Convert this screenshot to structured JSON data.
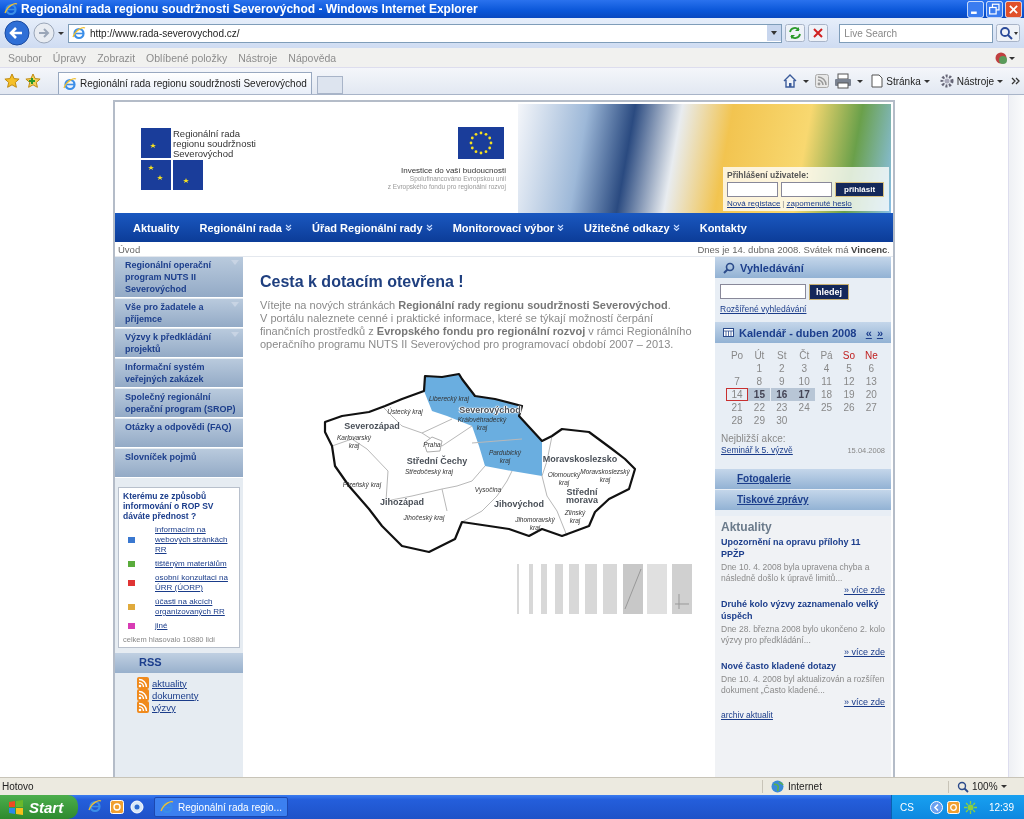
{
  "browser": {
    "title": "Regionální rada regionu soudržnosti Severovýchod - Windows Internet Explorer",
    "address": "http://www.rada-severovychod.cz/",
    "search_placeholder": "Live Search",
    "menu": [
      "Soubor",
      "Úpravy",
      "Zobrazit",
      "Oblíbené položky",
      "Nástroje",
      "Nápověda"
    ],
    "tab": "Regionální rada regionu soudržnosti Severovýchod",
    "tools": [
      "Stránka",
      "Nástroje"
    ]
  },
  "header": {
    "logo_lines": [
      "Regionální rada",
      "regionu soudržnosti",
      "Severovýchod"
    ],
    "eu_title": "Investice do vaší budoucnosti",
    "eu_lines": [
      "Spolufinancováno Evropskou unii",
      "z Evropského fondu pro regionální rozvoj"
    ],
    "login": {
      "title": "Přihlášení uživatele:",
      "button": "přihlásit",
      "links": [
        "Nová registace",
        "zapomenuté heslo"
      ],
      "separator": "|"
    }
  },
  "nav": [
    {
      "label": "Aktuality",
      "dropdown": false
    },
    {
      "label": "Regionální rada",
      "dropdown": true
    },
    {
      "label": "Úřad Regionální rady",
      "dropdown": true
    },
    {
      "label": "Monitorovací výbor",
      "dropdown": true
    },
    {
      "label": "Užitečné odkazy",
      "dropdown": true
    },
    {
      "label": "Kontakty",
      "dropdown": false
    }
  ],
  "breadcrumb": "Úvod",
  "date_text": "Dnes je 14. dubna 2008. Svátek má **Vincenc**.",
  "sidebar": {
    "items": [
      {
        "label": "Regionální operační program NUTS II Severovýchod",
        "dropdown": true
      },
      {
        "label": "Vše pro žadatele a příjemce",
        "dropdown": true
      },
      {
        "label": "Výzvy k předkládání projektů",
        "dropdown": true
      },
      {
        "label": "Informační systém veřejných zakázek",
        "dropdown": false
      },
      {
        "label": "Společný regionální operační program (SROP)",
        "dropdown": false
      },
      {
        "label": "Otázky a odpovědi (FAQ)",
        "dropdown": false
      },
      {
        "label": "Slovníček pojmů",
        "dropdown": false
      }
    ],
    "poll": {
      "question": "Kterému ze způsobů informování o ROP SV dáváte přednost ?",
      "options": [
        {
          "label": "informacím na webových stránkách RR",
          "color": "#3a78d0"
        },
        {
          "label": "tištěným materiálům",
          "color": "#5aac3c"
        },
        {
          "label": "osobní konzultaci na ÚRR (ÚORP)",
          "color": "#e03434"
        },
        {
          "label": "účasti na akcích organizovaných RR",
          "color": "#e0aa3c"
        },
        {
          "label": "jiné",
          "color": "#d83cb4"
        }
      ],
      "total": "celkem hlasovalo 10880 lidí"
    },
    "rss": {
      "title": "RSS",
      "links": [
        "aktuality",
        "dokumenty",
        "výzvy"
      ]
    }
  },
  "main": {
    "title": "Cesta k dotacím otevřena !",
    "paragraphs": [
      "Vítejte na nových stránkách **Regionální rady regionu soudržnosti Severovýchod**.",
      "V portálu naleznete cenné i praktické informace, které se týkají možností čerpání finančních prostředků z **Evropského fondu pro regionální rozvoj** v rámci Regionálního operačního programu NUTS II Severovýchod pro programovací období 2007 – 2013."
    ],
    "map": {
      "labels": [
        {
          "text": "Liberecký kraj",
          "kind": "kraj"
        },
        {
          "text": "Severovýchod",
          "kind": "region"
        },
        {
          "text": "Královéhradecký kraj",
          "kind": "kraj"
        },
        {
          "text": "Ústecký kraj",
          "kind": "kraj"
        },
        {
          "text": "Severozápad",
          "kind": "region"
        },
        {
          "text": "Karlovarský kraj",
          "kind": "kraj"
        },
        {
          "text": "Praha",
          "kind": "kraj"
        },
        {
          "text": "Střední Čechy",
          "kind": "region"
        },
        {
          "text": "Středočeský kraj",
          "kind": "kraj"
        },
        {
          "text": "Pardubický kraj",
          "kind": "kraj"
        },
        {
          "text": "Moravskoslezsko",
          "kind": "region"
        },
        {
          "text": "Moravskoslezský kraj",
          "kind": "kraj"
        },
        {
          "text": "Olomoucký kraj",
          "kind": "kraj"
        },
        {
          "text": "Střední morava",
          "kind": "region"
        },
        {
          "text": "Zlínský kraj",
          "kind": "kraj"
        },
        {
          "text": "Plzeňský kraj",
          "kind": "kraj"
        },
        {
          "text": "Jihozápad",
          "kind": "region"
        },
        {
          "text": "Vysočina",
          "kind": "kraj"
        },
        {
          "text": "Jihovýchod",
          "kind": "region"
        },
        {
          "text": "Jihočeský kraj",
          "kind": "kraj"
        },
        {
          "text": "Jihomoravský kraj",
          "kind": "kraj"
        }
      ]
    }
  },
  "right": {
    "search": {
      "title": "Vyhledávání",
      "button": "hledej",
      "link": "Rozšířené vyhledávání"
    },
    "calendar": {
      "title": "Kalendář - duben 2008",
      "prev": "«",
      "next": "»",
      "weekdays": [
        {
          "label": "Po",
          "weekend": false
        },
        {
          "label": "Út",
          "weekend": false
        },
        {
          "label": "St",
          "weekend": false
        },
        {
          "label": "Čt",
          "weekend": false
        },
        {
          "label": "Pá",
          "weekend": false
        },
        {
          "label": "So",
          "weekend": true
        },
        {
          "label": "Ne",
          "weekend": true
        }
      ],
      "weeks": [
        {
          "kind": "first",
          "days": [
            {
              "label": "1",
              "today": false,
              "event": false
            },
            {
              "label": "2",
              "today": false,
              "event": false
            },
            {
              "label": "3",
              "today": false,
              "event": false
            },
            {
              "label": "4",
              "today": false,
              "event": false
            },
            {
              "label": "5",
              "today": false,
              "event": false
            },
            {
              "label": "6",
              "today": false,
              "event": false
            }
          ]
        },
        {
          "kind": "full",
          "days": [
            {
              "label": "7",
              "today": false,
              "event": false
            },
            {
              "label": "8",
              "today": false,
              "event": false
            },
            {
              "label": "9",
              "today": false,
              "event": false
            },
            {
              "label": "10",
              "today": false,
              "event": false
            },
            {
              "label": "11",
              "today": false,
              "event": false
            },
            {
              "label": "12",
              "today": false,
              "event": false
            },
            {
              "label": "13",
              "today": false,
              "event": false
            }
          ]
        },
        {
          "kind": "full",
          "days": [
            {
              "label": "14",
              "today": true,
              "event": false
            },
            {
              "label": "15",
              "today": false,
              "event": true
            },
            {
              "label": "16",
              "today": false,
              "event": true
            },
            {
              "label": "17",
              "today": false,
              "event": true
            },
            {
              "label": "18",
              "today": false,
              "event": false
            },
            {
              "label": "19",
              "today": false,
              "event": false
            },
            {
              "label": "20",
              "today": false,
              "event": false
            }
          ]
        },
        {
          "kind": "full",
          "days": [
            {
              "label": "21",
              "today": false,
              "event": false
            },
            {
              "label": "22",
              "today": false,
              "event": false
            },
            {
              "label": "23",
              "today": false,
              "event": false
            },
            {
              "label": "24",
              "today": false,
              "event": false
            },
            {
              "label": "25",
              "today": false,
              "event": false
            },
            {
              "label": "26",
              "today": false,
              "event": false
            },
            {
              "label": "27",
              "today": false,
              "event": false
            }
          ]
        },
        {
          "kind": "last",
          "days": [
            {
              "label": "28",
              "today": false,
              "event": false
            },
            {
              "label": "29",
              "today": false,
              "event": false
            },
            {
              "label": "30",
              "today": false,
              "event": false
            }
          ]
        }
      ],
      "events_title": "Nejbližší akce:",
      "event": {
        "label": "Seminář k 5. výzvě",
        "date": "15.04.2008"
      }
    },
    "links": [
      "Fotogalerie",
      "Tiskové zprávy"
    ],
    "news": {
      "title": "Aktuality",
      "items": [
        {
          "title": "Upozornění na opravu přílohy 11 PPŽP",
          "text": "Dne 10. 4. 2008 byla upravena chyba a následně došlo k úpravě limitů...",
          "more": "» více zde"
        },
        {
          "title": "Druhé kolo výzvy zaznamenalo velký úspěch",
          "text": "Dne 28. března 2008 bylo ukončeno 2. kolo výzvy pro předkládání...",
          "more": "» více zde"
        },
        {
          "title": "Nové často kladené dotazy",
          "text": "Dne 10. 4. 2008 byl aktualizován a rozšířen dokument „Často kladené...",
          "more": "» více zde"
        }
      ],
      "archive": "archiv aktualit"
    }
  },
  "status_bar": {
    "text": "Hotovo",
    "zone": "Internet",
    "zoom": "100%"
  },
  "taskbar": {
    "start": "Start",
    "task": "Regionální rada regio...",
    "lang": "CS",
    "time": "12:39"
  }
}
